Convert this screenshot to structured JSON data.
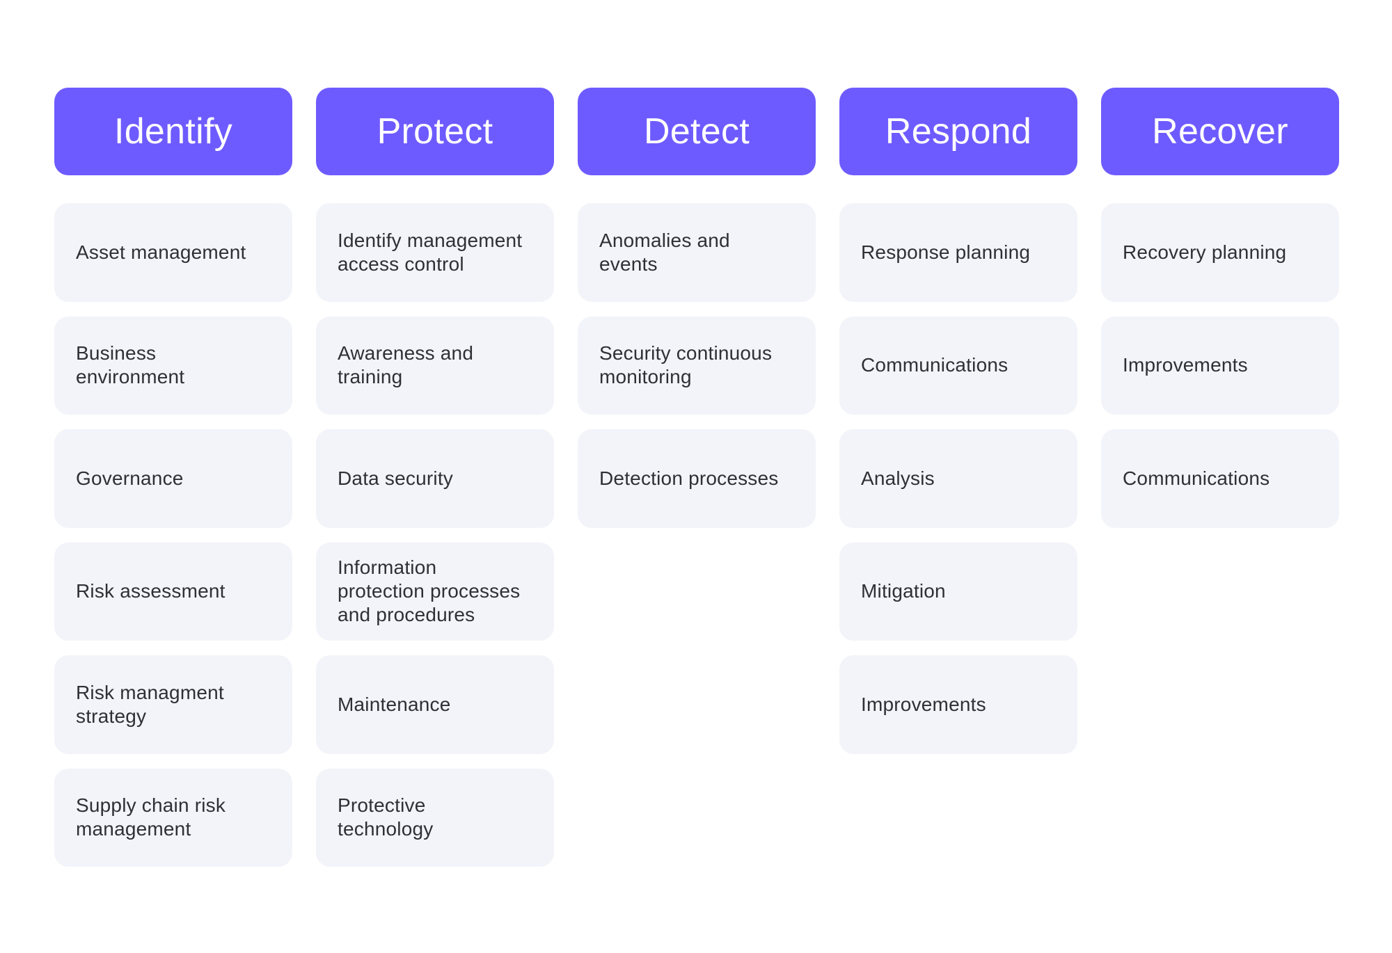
{
  "colors": {
    "header_bg": "#6E5BFF",
    "header_text": "#FFFFFF",
    "card_bg": "#F3F4F9",
    "card_text": "#2F3035"
  },
  "columns": [
    {
      "title": "Identify",
      "items": [
        "Asset management",
        "Business\nenvironment",
        "Governance",
        "Risk assessment",
        "Risk managment\nstrategy",
        "Supply chain risk\nmanagement"
      ]
    },
    {
      "title": "Protect",
      "items": [
        "Identify management\naccess control",
        "Awareness and\ntraining",
        "Data security",
        "Information\nprotection processes\nand procedures",
        "Maintenance",
        "Protective\ntechnology"
      ]
    },
    {
      "title": "Detect",
      "items": [
        "Anomalies and\nevents",
        "Security continuous\nmonitoring",
        "Detection processes"
      ]
    },
    {
      "title": "Respond",
      "items": [
        "Response planning",
        "Communications",
        "Analysis",
        "Mitigation",
        "Improvements"
      ]
    },
    {
      "title": "Recover",
      "items": [
        "Recovery planning",
        "Improvements",
        "Communications"
      ]
    }
  ]
}
